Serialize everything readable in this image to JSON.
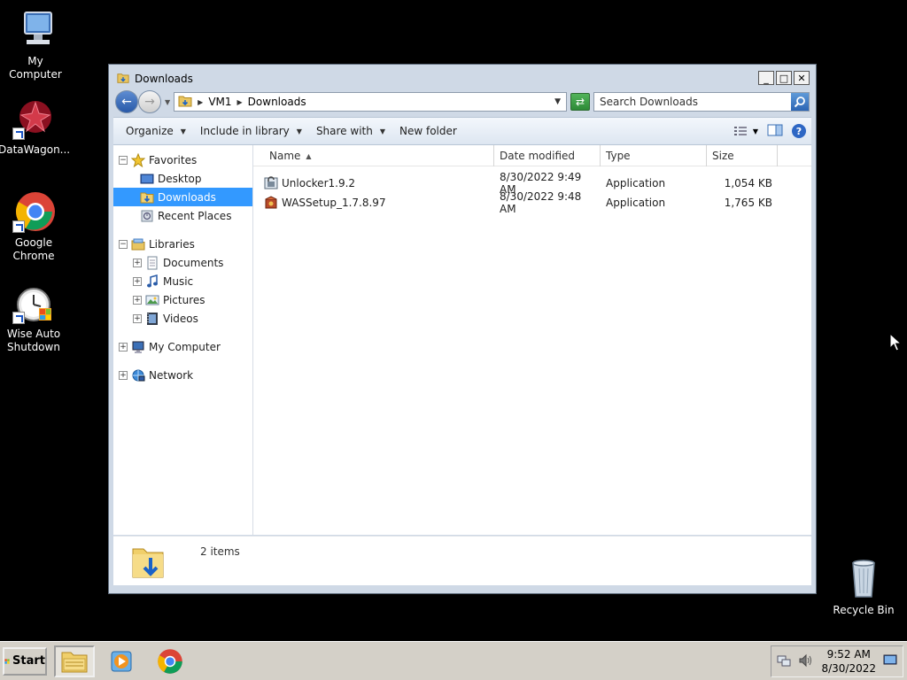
{
  "desktop": {
    "icons": [
      {
        "label": "My Computer"
      },
      {
        "label": "DataWagon..."
      },
      {
        "label": "Google Chrome"
      },
      {
        "label": "Wise Auto Shutdown"
      },
      {
        "label": "Recycle Bin"
      }
    ]
  },
  "window": {
    "title": "Downloads",
    "controls": {
      "minimize": "_",
      "maximize": "□",
      "close": "✕"
    },
    "address": {
      "crumbs": [
        "VM1",
        "Downloads"
      ]
    },
    "search": {
      "placeholder": "Search Downloads"
    },
    "commands": {
      "organize": "Organize",
      "include_in_library": "Include in library",
      "share_with": "Share with",
      "new_folder": "New folder"
    },
    "nav": {
      "favorites": "Favorites",
      "desktop": "Desktop",
      "downloads": "Downloads",
      "recent_places": "Recent Places",
      "libraries": "Libraries",
      "documents": "Documents",
      "music": "Music",
      "pictures": "Pictures",
      "videos": "Videos",
      "my_computer": "My Computer",
      "network": "Network",
      "expand_symbol": "+",
      "collapse_symbol": "−"
    },
    "columns": {
      "name": "Name",
      "date_modified": "Date modified",
      "type": "Type",
      "size": "Size"
    },
    "files": [
      {
        "name": "Unlocker1.9.2",
        "date": "8/30/2022 9:49 AM",
        "type": "Application",
        "size": "1,054 KB",
        "icon": "unlocker-app-icon"
      },
      {
        "name": "WASSetup_1.7.8.97",
        "date": "8/30/2022 9:48 AM",
        "type": "Application",
        "size": "1,765 KB",
        "icon": "setup-app-icon"
      }
    ],
    "details": {
      "item_count": "2 items"
    }
  },
  "taskbar": {
    "start_label": "Start",
    "clock_time": "9:52 AM",
    "clock_date": "8/30/2022"
  },
  "colors": {
    "selection": "#3399ff",
    "window_frame": "#cfd9e6",
    "desktop_bg": "#000000",
    "taskbar_bg": "#d4d0c8"
  }
}
